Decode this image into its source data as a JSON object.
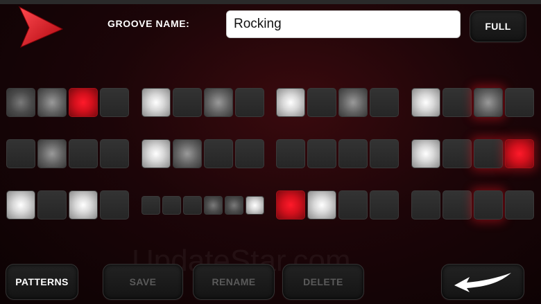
{
  "header": {
    "groove_label": "GROOVE NAME:",
    "groove_value": "Rocking",
    "full_label": "FULL"
  },
  "footer": {
    "patterns_label": "PATTERNS",
    "save_label": "SAVE",
    "rename_label": "RENAME",
    "delete_label": "DELETE"
  },
  "watermark": "UpdateStar.com",
  "colors": {
    "accent_red": "#d3101c",
    "background": "#1c0508",
    "pad_off": "#2b2b2b"
  },
  "icons": {
    "play": "play-triangle-icon",
    "back": "swoosh-arrow-back-icon"
  },
  "pad_levels_legend": "0=off,1=soft,2=medium,3=full,r=red accent",
  "rows": [
    {
      "groups": [
        [
          "1",
          "2",
          "r",
          "0"
        ],
        [
          "3",
          "0",
          "2",
          "0"
        ],
        [
          "3",
          "0",
          "2",
          "0"
        ],
        [
          "3",
          "0",
          "2g",
          "0"
        ]
      ]
    },
    {
      "groups": [
        [
          "0",
          "2",
          "0",
          "0"
        ],
        [
          "3",
          "2",
          "0",
          "0"
        ],
        [
          "0",
          "0",
          "0",
          "0"
        ],
        [
          "3",
          "0",
          "0g",
          "rg"
        ]
      ]
    },
    {
      "groups": [
        [
          "3",
          "0",
          "3",
          "0"
        ],
        [
          "0",
          "0",
          "0",
          "1",
          "1",
          "3"
        ],
        [
          "r",
          "3",
          "0",
          "0"
        ],
        [
          "0",
          "0",
          "0g",
          "0"
        ]
      ]
    }
  ]
}
